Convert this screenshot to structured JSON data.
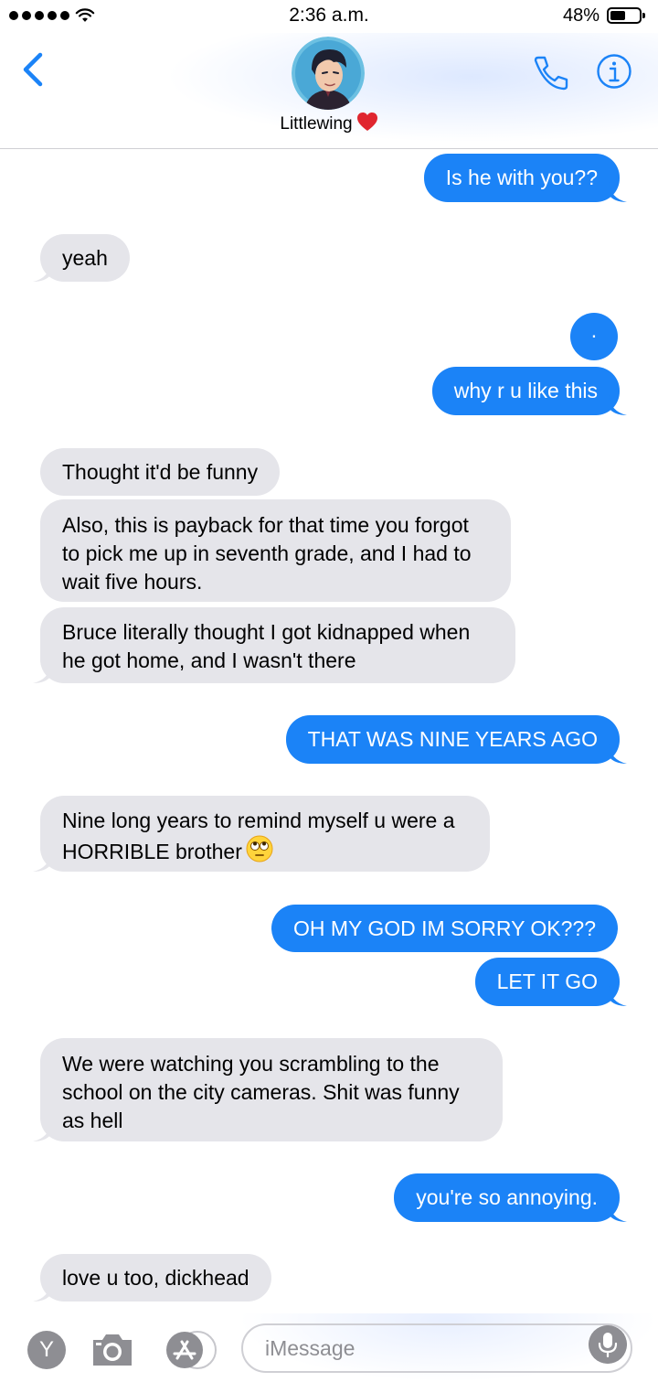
{
  "status_bar": {
    "time": "2:36 a.m.",
    "battery_percent": "48%",
    "signal_bars": 5,
    "battery_level": 0.48
  },
  "header": {
    "contact_name": "Littlewing",
    "contact_emoji": "red-heart",
    "back_icon": "chevron-left-icon",
    "call_icon": "phone-icon",
    "info_icon": "info-icon"
  },
  "colors": {
    "accent": "#1b83f7",
    "incoming_bubble": "#e5e5ea",
    "outgoing_text": "#ffffff"
  },
  "messages": [
    {
      "from": "me",
      "text": "Is he with you??"
    },
    {
      "from": "them",
      "text": "yeah"
    },
    {
      "from": "me",
      "text": "."
    },
    {
      "from": "me",
      "text": "why r u like this"
    },
    {
      "from": "them",
      "text": "Thought it'd be funny"
    },
    {
      "from": "them",
      "text": "Also, this is payback for that time you forgot\nto pick me up in seventh grade, and I had to\nwait five hours."
    },
    {
      "from": "them",
      "text": "Bruce literally thought I got kidnapped when\nhe got home, and I wasn't there"
    },
    {
      "from": "me",
      "text": "THAT WAS NINE YEARS AGO"
    },
    {
      "from": "them",
      "text": "Nine long years to remind myself u were a\nHORRIBLE brother",
      "emoji": "eye-roll-emoji"
    },
    {
      "from": "me",
      "text": "OH MY GOD IM SORRY OK???"
    },
    {
      "from": "me",
      "text": "LET IT GO"
    },
    {
      "from": "them",
      "text": "We were watching you scrambling to the\nschool on the city cameras. Shit was funny\nas hell"
    },
    {
      "from": "me",
      "text": "you're so annoying."
    },
    {
      "from": "them",
      "text": "love u too, dickhead"
    }
  ],
  "composer": {
    "placeholder": "iMessage",
    "app_y_label": "Y",
    "camera_icon": "camera-icon",
    "appstore_icon": "app-store-icon",
    "mic_icon": "microphone-icon"
  }
}
